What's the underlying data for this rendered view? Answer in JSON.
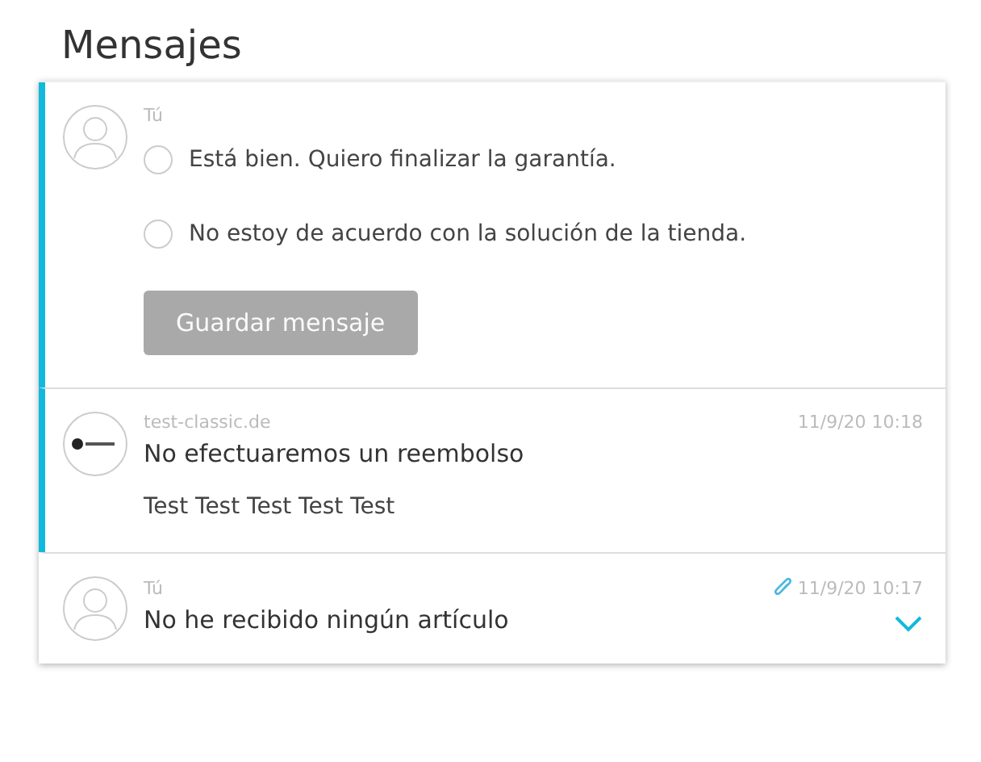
{
  "title": "Mensajes",
  "messages": [
    {
      "kind": "compose",
      "highlighted": true,
      "author": "Tú",
      "options": [
        {
          "label": "Está bien. Quiero finalizar la garantía.",
          "selected": false
        },
        {
          "label": "No estoy de acuerdo con la solución de la tienda.",
          "selected": false
        }
      ],
      "button": {
        "label": "Guardar mensaje",
        "disabled": true
      }
    },
    {
      "kind": "message",
      "highlighted": true,
      "avatar": {
        "kind": "logo"
      },
      "author": "test-classic.de",
      "date": "11/9/20 10:18",
      "subject": "No efectuaremos un reembolso",
      "body": "Test Test Test Test Test",
      "attachment": false,
      "expanded": true
    },
    {
      "kind": "message",
      "highlighted": false,
      "avatar": {
        "kind": "person"
      },
      "author": "Tú",
      "date": "11/9/20 10:17",
      "subject": "No he recibido ningún artículo",
      "attachment": true,
      "expanded": false
    }
  ]
}
